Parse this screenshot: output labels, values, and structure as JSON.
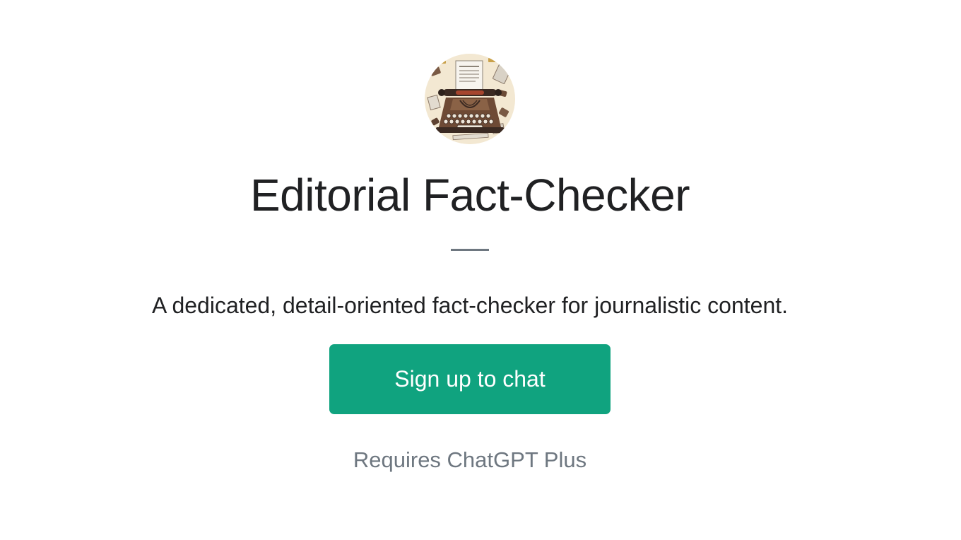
{
  "gpt": {
    "avatar_icon": "typewriter-icon",
    "title": "Editorial Fact-Checker",
    "description": "A dedicated, detail-oriented fact-checker for journalistic content."
  },
  "actions": {
    "signup_label": "Sign up to chat"
  },
  "footer": {
    "requirement": "Requires ChatGPT Plus"
  },
  "colors": {
    "accent": "#10a37f",
    "title_text": "#202123",
    "muted_text": "#6e7780",
    "divider": "#6e7780",
    "background": "#ffffff"
  }
}
